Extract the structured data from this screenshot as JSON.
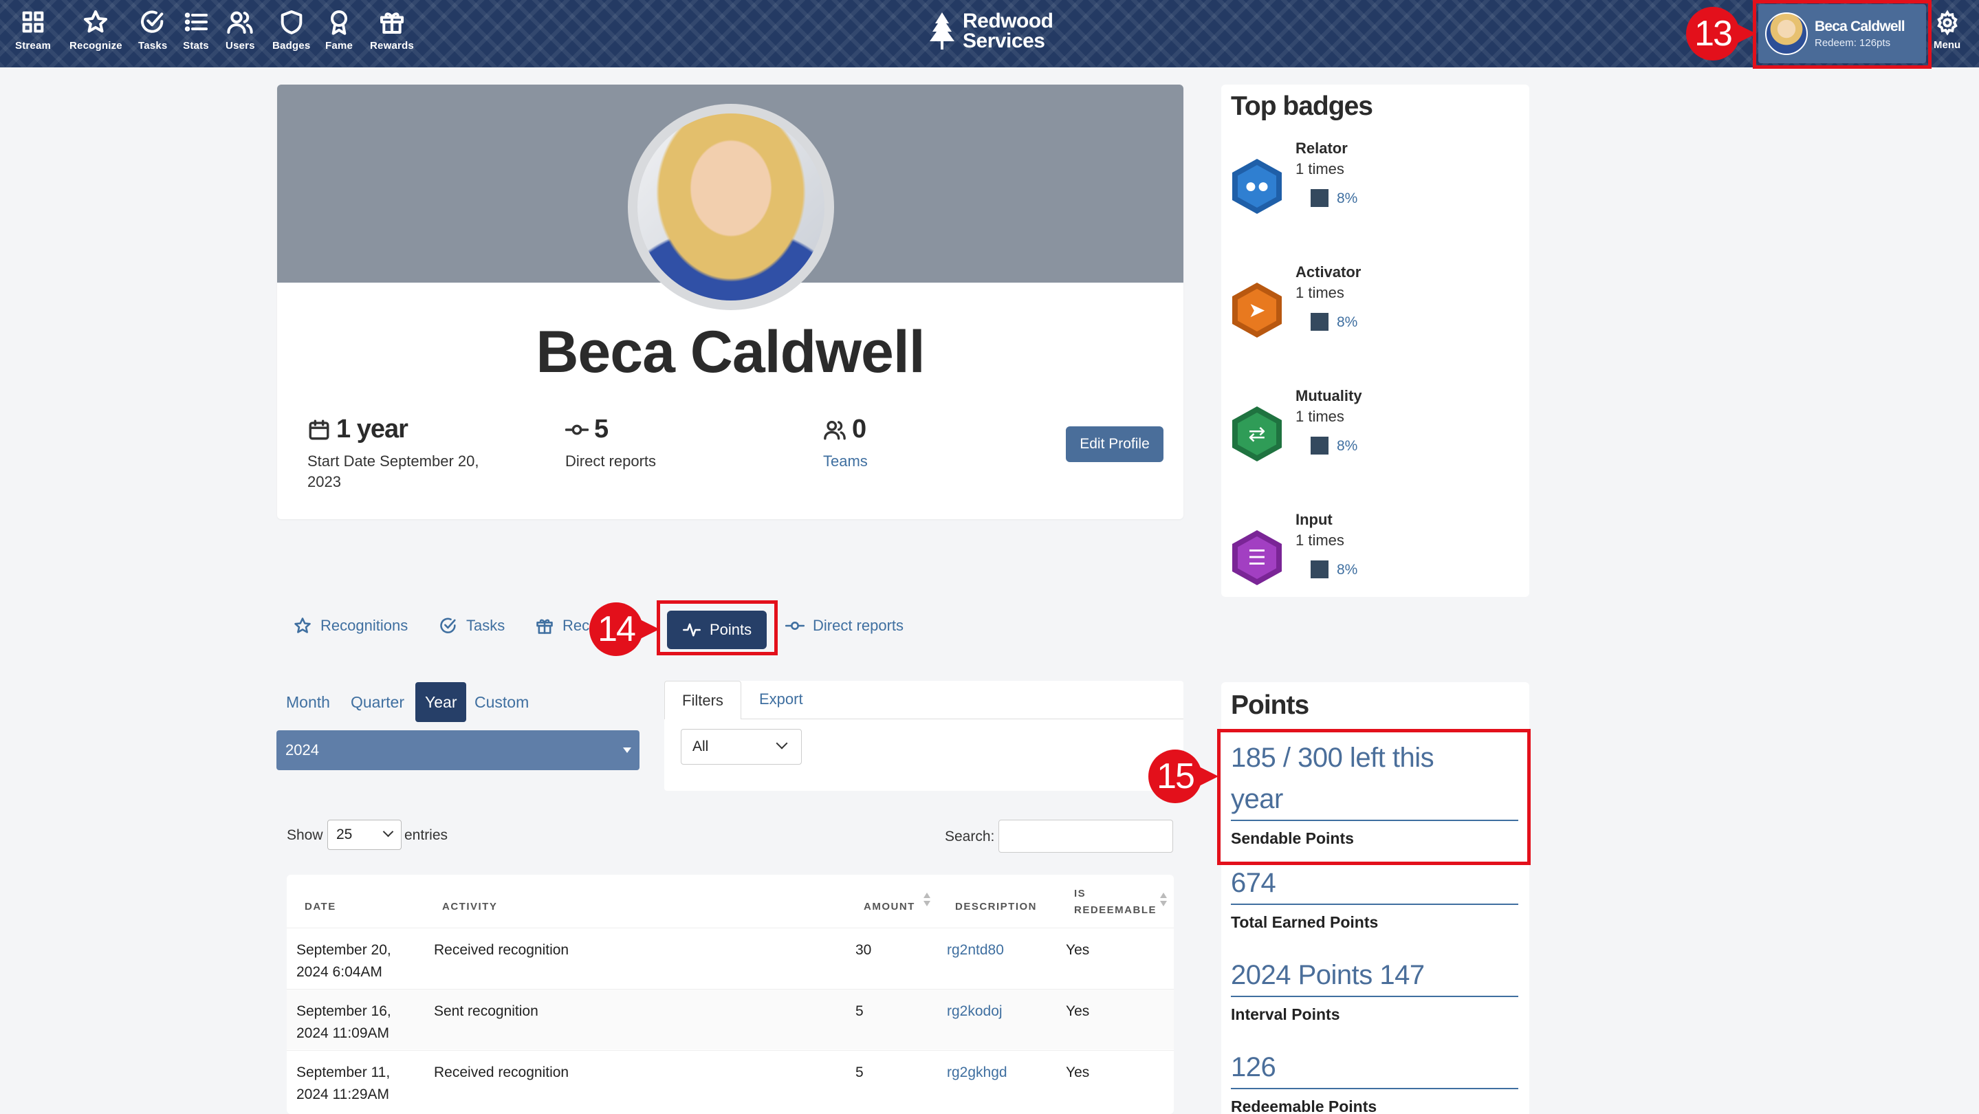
{
  "nav": {
    "items": [
      {
        "label": "Stream",
        "icon": "grid-icon"
      },
      {
        "label": "Recognize",
        "icon": "star-icon"
      },
      {
        "label": "Tasks",
        "icon": "check-circle-icon"
      },
      {
        "label": "Stats",
        "icon": "list-icon"
      },
      {
        "label": "Users",
        "icon": "users-icon"
      },
      {
        "label": "Badges",
        "icon": "shield-icon"
      },
      {
        "label": "Fame",
        "icon": "award-icon"
      },
      {
        "label": "Rewards",
        "icon": "gift-icon"
      }
    ],
    "brand": {
      "line1": "Redwood",
      "line2": "Services"
    },
    "user": {
      "name": "Beca Caldwell",
      "redeem": "Redeem: 126pts"
    },
    "menu_label": "Menu"
  },
  "annotations": {
    "m13": "13",
    "m14": "14",
    "m15": "15"
  },
  "profile": {
    "name": "Beca Caldwell",
    "tenure": "1 year",
    "start_date": "Start Date September 20, 2023",
    "direct_reports_count": "5",
    "direct_reports_label": "Direct reports",
    "teams_count": "0",
    "teams_label": "Teams",
    "edit_button": "Edit Profile"
  },
  "top_badges": {
    "title": "Top badges",
    "items": [
      {
        "name": "Relator",
        "times": "1 times",
        "pct": "8%",
        "color": "#2f7fd1"
      },
      {
        "name": "Activator",
        "times": "1 times",
        "pct": "8%",
        "color": "#e8791f"
      },
      {
        "name": "Mutuality",
        "times": "1 times",
        "pct": "8%",
        "color": "#2f9c57"
      },
      {
        "name": "Input",
        "times": "1 times",
        "pct": "8%",
        "color": "#a23fc2"
      }
    ]
  },
  "tabs": {
    "recognitions": "Recognitions",
    "tasks": "Tasks",
    "rewards": "Rec",
    "points": "Points",
    "direct_reports": "Direct reports"
  },
  "period": {
    "month": "Month",
    "quarter": "Quarter",
    "year": "Year",
    "custom": "Custom",
    "selected_year": "2024"
  },
  "filters": {
    "filters_tab": "Filters",
    "export_tab": "Export",
    "select_value": "All"
  },
  "table_controls": {
    "show": "Show",
    "entries_value": "25",
    "entries": "entries",
    "search": "Search:"
  },
  "table": {
    "headers": {
      "date": "DATE",
      "activity": "ACTIVITY",
      "amount": "AMOUNT",
      "description": "DESCRIPTION",
      "redeemable_1": "IS",
      "redeemable_2": "REDEEMABLE"
    },
    "rows": [
      {
        "date1": "September 20,",
        "date2": "2024 6:04AM",
        "activity": "Received recognition",
        "amount": "30",
        "description": "rg2ntd80",
        "redeemable": "Yes"
      },
      {
        "date1": "September 16,",
        "date2": "2024 11:09AM",
        "activity": "Sent recognition",
        "amount": "5",
        "description": "rg2kodoj",
        "redeemable": "Yes"
      },
      {
        "date1": "September 11,",
        "date2": "2024 11:29AM",
        "activity": "Received recognition",
        "amount": "5",
        "description": "rg2gkhgd",
        "redeemable": "Yes"
      }
    ]
  },
  "points": {
    "title": "Points",
    "sendable_value_1": "185 / 300 left this",
    "sendable_value_2": "year",
    "sendable_label": "Sendable Points",
    "total_value": "674",
    "total_label": "Total Earned Points",
    "interval_value": "2024 Points 147",
    "interval_label": "Interval Points",
    "redeemable_value": "126",
    "redeemable_label": "Redeemable Points"
  }
}
